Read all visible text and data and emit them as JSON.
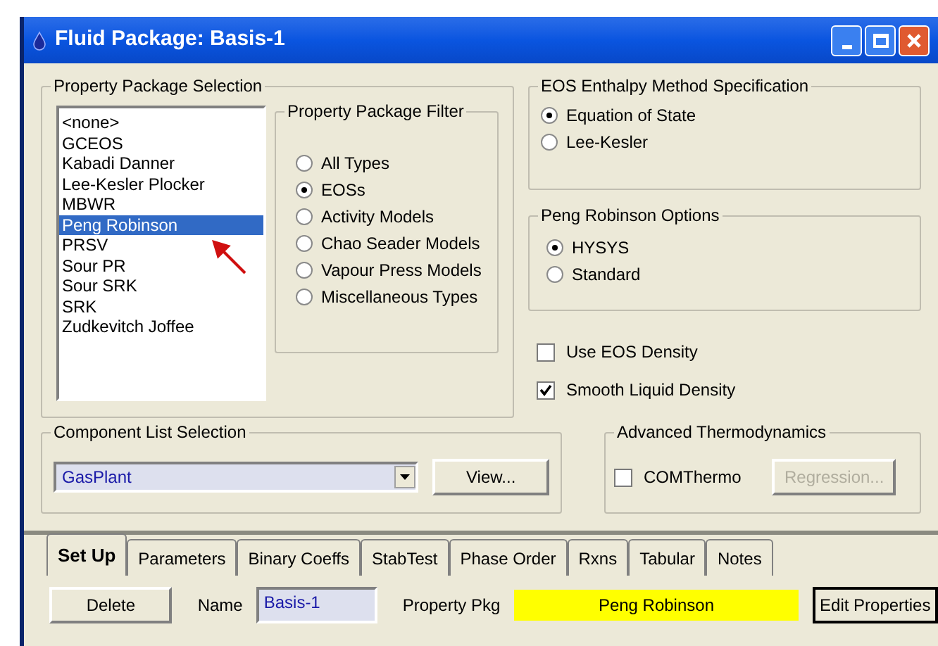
{
  "window": {
    "title": "Fluid Package: Basis-1"
  },
  "property_package_selection": {
    "title": "Property Package Selection",
    "packages": [
      {
        "label": "<none>",
        "selected": false
      },
      {
        "label": "GCEOS",
        "selected": false
      },
      {
        "label": "Kabadi Danner",
        "selected": false
      },
      {
        "label": "Lee-Kesler Plocker",
        "selected": false
      },
      {
        "label": "MBWR",
        "selected": false
      },
      {
        "label": "Peng Robinson",
        "selected": true
      },
      {
        "label": "PRSV",
        "selected": false
      },
      {
        "label": "Sour PR",
        "selected": false
      },
      {
        "label": "Sour SRK",
        "selected": false
      },
      {
        "label": "SRK",
        "selected": false
      },
      {
        "label": "Zudkevitch Joffee",
        "selected": false
      }
    ],
    "filter": {
      "title": "Property Package Filter",
      "options": [
        {
          "label": "All Types",
          "selected": false
        },
        {
          "label": "EOSs",
          "selected": true
        },
        {
          "label": "Activity Models",
          "selected": false
        },
        {
          "label": "Chao Seader Models",
          "selected": false
        },
        {
          "label": "Vapour Press Models",
          "selected": false
        },
        {
          "label": "Miscellaneous Types",
          "selected": false
        }
      ]
    }
  },
  "eos_enthalpy": {
    "title": "EOS Enthalpy Method Specification",
    "options": [
      {
        "label": "Equation of State",
        "selected": true
      },
      {
        "label": "Lee-Kesler",
        "selected": false
      }
    ]
  },
  "peng_robinson_options": {
    "title": "Peng Robinson Options",
    "options": [
      {
        "label": "HYSYS",
        "selected": true
      },
      {
        "label": "Standard",
        "selected": false
      }
    ]
  },
  "checkboxes": [
    {
      "label": "Use EOS Density",
      "checked": false
    },
    {
      "label": "Smooth Liquid Density",
      "checked": true
    }
  ],
  "component_list": {
    "title": "Component List Selection",
    "value": "GasPlant",
    "button": "View..."
  },
  "advanced_thermo": {
    "title": "Advanced Thermodynamics",
    "checkbox": {
      "label": "COMThermo",
      "checked": false
    },
    "button": {
      "label": "Regression...",
      "disabled": true
    }
  },
  "tabs": [
    {
      "label": "Set Up",
      "selected": true
    },
    {
      "label": "Parameters",
      "selected": false
    },
    {
      "label": "Binary Coeffs",
      "selected": false
    },
    {
      "label": "StabTest",
      "selected": false
    },
    {
      "label": "Phase Order",
      "selected": false
    },
    {
      "label": "Rxns",
      "selected": false
    },
    {
      "label": "Tabular",
      "selected": false
    },
    {
      "label": "Notes",
      "selected": false
    }
  ],
  "footer": {
    "delete_button": "Delete",
    "name_label": "Name",
    "name_value": "Basis-1",
    "property_pkg_label": "Property Pkg",
    "property_pkg_value": "Peng Robinson",
    "edit_button": "Edit Properties"
  }
}
